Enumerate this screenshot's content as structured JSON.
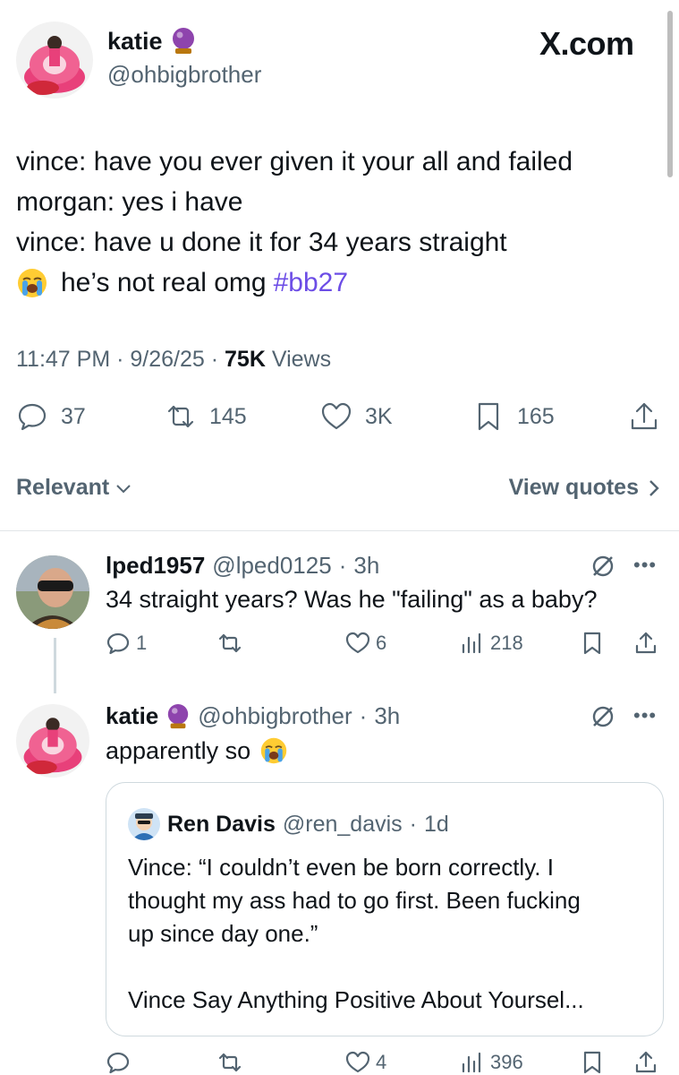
{
  "header": {
    "name": "katie",
    "handle": "@ohbigbrother",
    "site_logo": "X.com",
    "name_icon": "crystal-ball-icon"
  },
  "tweet": {
    "lines": [
      "vince: have you ever given it your all and failed",
      "morgan: yes i have",
      "vince: have u done it for 34 years straight"
    ],
    "last_line_text": "he’s not real omg",
    "hashtag": "#bb27",
    "time": "11:47 PM",
    "date": "9/26/25",
    "views_count": "75K",
    "views_label": "Views"
  },
  "stats": {
    "replies": "37",
    "reposts": "145",
    "likes": "3K",
    "bookmarks": "165"
  },
  "sort": {
    "relevant_label": "Relevant",
    "view_quotes_label": "View quotes"
  },
  "replies": [
    {
      "name": "lped1957",
      "handle": "@lped0125",
      "time": "3h",
      "text": "34 straight years?  Was he \"failing\" as a baby?",
      "replies": "1",
      "reposts": "",
      "likes": "6",
      "views": "218"
    },
    {
      "name": "katie",
      "handle": "@ohbigbrother",
      "time": "3h",
      "text": "apparently so",
      "replies": "",
      "reposts": "",
      "likes": "4",
      "views": "396",
      "quote": {
        "name": "Ren Davis",
        "handle": "@ren_davis",
        "time": "1d",
        "text": "Vince: “I couldn’t even be born correctly. I\nthought my ass had to go first. Been fucking\nup since day one.”\n\nVince Say Anything Positive About Yoursel..."
      }
    }
  ],
  "colors": {
    "text": "#0f1419",
    "secondary": "#536471",
    "hashtag": "#6c4de6",
    "border": "#cfd9de"
  }
}
